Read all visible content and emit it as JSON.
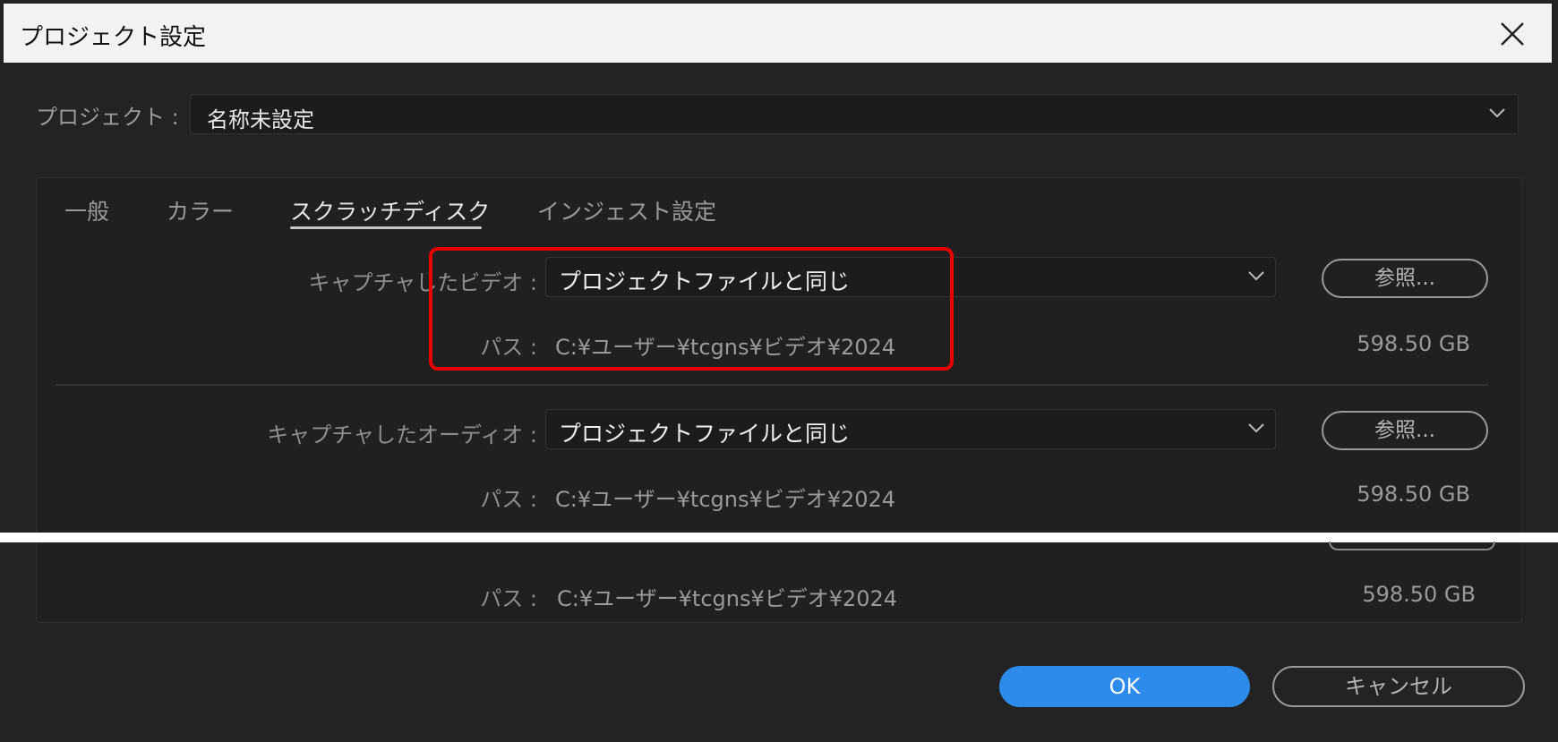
{
  "window": {
    "title": "プロジェクト設定"
  },
  "project": {
    "label": "プロジェクト :",
    "value": "名称未設定"
  },
  "tabs": [
    {
      "label": "一般"
    },
    {
      "label": "カラー"
    },
    {
      "label": "スクラッチディスク"
    },
    {
      "label": "インジェスト設定"
    }
  ],
  "active_tab": "スクラッチディスク",
  "rows": [
    {
      "label": "キャプチャしたビデオ :",
      "value": "プロジェクトファイルと同じ",
      "browse": "参照...",
      "path_label": "パス :",
      "path": "C:¥ユーザー¥tcgns¥ビデオ¥2024",
      "size": "598.50 GB"
    },
    {
      "label": "キャプチャしたオーディオ :",
      "value": "プロジェクトファイルと同じ",
      "browse": "参照...",
      "path_label": "パス :",
      "path": "C:¥ユーザー¥tcgns¥ビデオ¥2024",
      "size": "598.50 GB"
    },
    {
      "path_label": "パス :",
      "path": "C:¥ユーザー¥tcgns¥ビデオ¥2024",
      "size": "598.50 GB"
    }
  ],
  "buttons": {
    "ok": "OK",
    "cancel": "キャンセル"
  },
  "colors": {
    "accent": "#2d8ceb",
    "highlight": "#e60000",
    "background": "#232323"
  }
}
